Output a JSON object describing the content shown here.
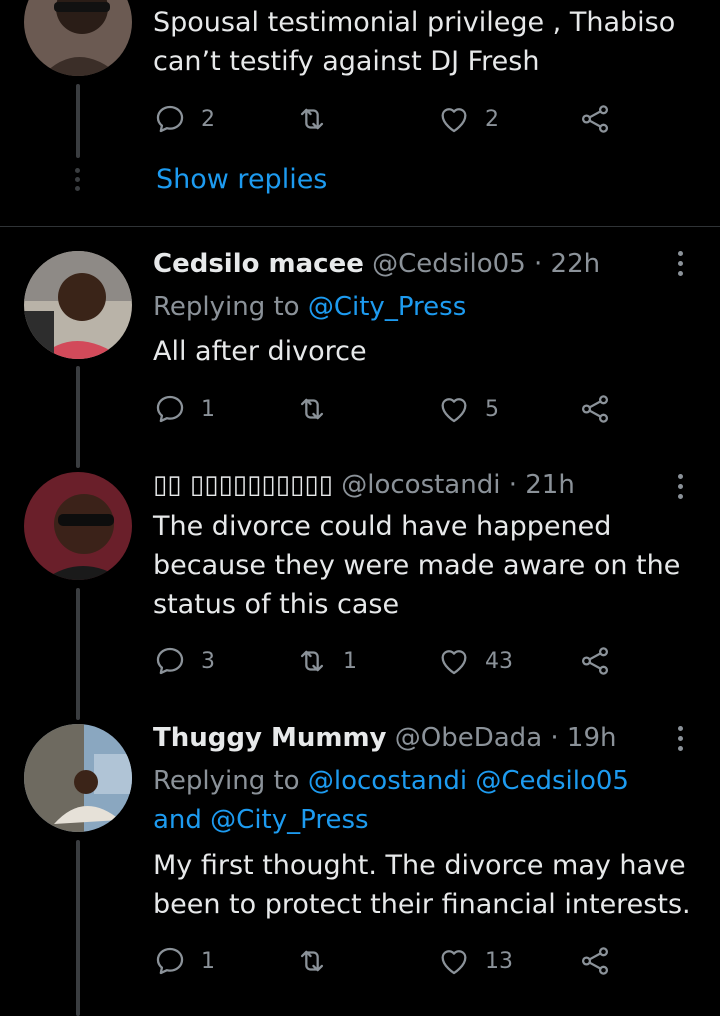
{
  "top_tweet": {
    "text": "Spousal testimonial privilege , Thabiso can’t testify against DJ Fresh",
    "reply_count": "2",
    "retweet_count": "",
    "like_count": "2"
  },
  "show_replies_label": "Show replies",
  "tweets": [
    {
      "name": "Cedsilo macee",
      "handle": "@Cedsilo05",
      "time": "· 22h",
      "replying_prefix": "Replying to",
      "mentions": "@City_Press",
      "text": "All after divorce",
      "reply_count": "1",
      "retweet_count": "",
      "like_count": "5"
    },
    {
      "name": "▯▯ ▯▯▯▯▯▯▯▯▯▯",
      "handle": "@locostandi",
      "time": "· 21h",
      "text": "The divorce could have happened because they were made aware on the status of this case",
      "reply_count": "3",
      "retweet_count": "1",
      "like_count": "43"
    },
    {
      "name": "Thuggy Mummy",
      "handle": "@ObeDada",
      "time": "· 19h",
      "replying_prefix": "Replying to",
      "mentions": "@locostandi @Cedsilo05 and @City_Press",
      "text": "My first thought. The divorce may have been to protect their financial interests.",
      "reply_count": "1",
      "retweet_count": "",
      "like_count": "13"
    }
  ],
  "icons": {
    "reply": "reply-icon",
    "retweet": "retweet-icon",
    "like": "heart-icon",
    "share": "share-icon",
    "more": "more-vertical-icon"
  },
  "colors": {
    "background": "#000000",
    "accent": "#1d9bf0",
    "secondary_text": "#8b9299",
    "primary_text": "#e7e9ea"
  }
}
